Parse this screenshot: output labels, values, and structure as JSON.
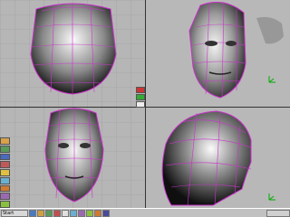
{
  "app": {
    "title": ""
  },
  "colors": {
    "mesh": "#cc33cc",
    "viewport_bg": "#b6b6b6",
    "grid": "#9a9a9a",
    "taskbar": "#c0c0c0"
  },
  "viewports": [
    {
      "id": "top-left",
      "view": "top"
    },
    {
      "id": "top-right",
      "view": "perspective"
    },
    {
      "id": "bottom-left",
      "view": "front"
    },
    {
      "id": "bottom-right",
      "view": "side"
    }
  ],
  "side_toolbar": {
    "icons": [
      "render-icon",
      "select-icon",
      "move-icon",
      "rotate-icon",
      "scale-icon",
      "paint-icon",
      "light-icon",
      "camera-icon",
      "material-icon"
    ]
  },
  "mid_toolbar": {
    "icons": [
      "red-swatch-icon",
      "green-swatch-icon",
      "white-swatch-icon"
    ]
  },
  "taskbar": {
    "start_label": "Start",
    "items": [
      "app-icon-1",
      "app-icon-2",
      "app-icon-3",
      "app-icon-4",
      "app-icon-5",
      "app-icon-6",
      "app-icon-7",
      "app-icon-8",
      "app-icon-9",
      "app-icon-10"
    ]
  }
}
